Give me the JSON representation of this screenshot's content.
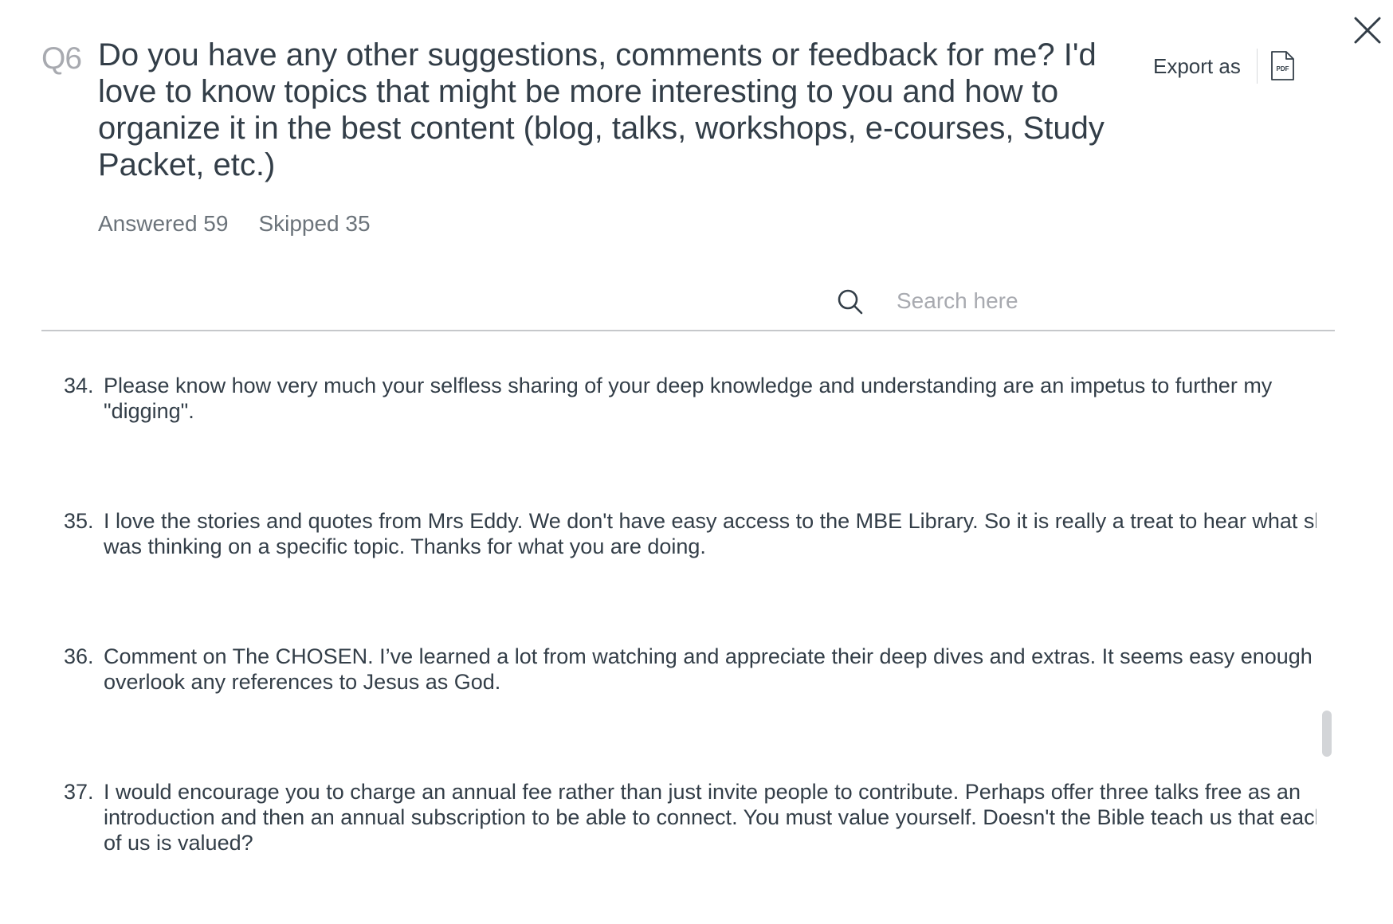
{
  "question": {
    "number": "Q6",
    "title": "Do you have any other suggestions, comments or feedback for me? I'd love to know topics that might be more interesting to you and how to organize it in the best content (blog, talks, workshops, e-courses, Study Packet, etc.)"
  },
  "export": {
    "label": "Export as",
    "format_icon": "pdf-file-icon"
  },
  "stats": {
    "answered": "Answered 59",
    "skipped": "Skipped 35"
  },
  "search": {
    "placeholder": "Search here",
    "value": ""
  },
  "responses": [
    {
      "number": "34.",
      "text": "Please know how very much your selfless sharing of your deep knowledge and understanding are an impetus to further my \"digging\"."
    },
    {
      "number": "35.",
      "text": "I love the stories and quotes from Mrs Eddy. We don't have easy access to the MBE Library. So it is really a treat to hear what she was thinking on a specific topic. Thanks for what you are doing."
    },
    {
      "number": "36.",
      "text": "Comment on The CHOSEN. I’ve learned a lot from watching and appreciate their deep dives and extras. It seems easy enough to overlook any references to Jesus as God."
    },
    {
      "number": "37.",
      "text": "I would encourage you to charge an annual fee rather than just invite people to contribute. Perhaps offer three talks free as an introduction and then an annual subscription to be able to connect. You must value yourself. Doesn't the Bible teach us that each of us is valued?"
    }
  ],
  "colors": {
    "text": "#333e48",
    "muted": "#6b737a",
    "placeholder": "#a8aab0",
    "divider": "#c6c8cb"
  }
}
